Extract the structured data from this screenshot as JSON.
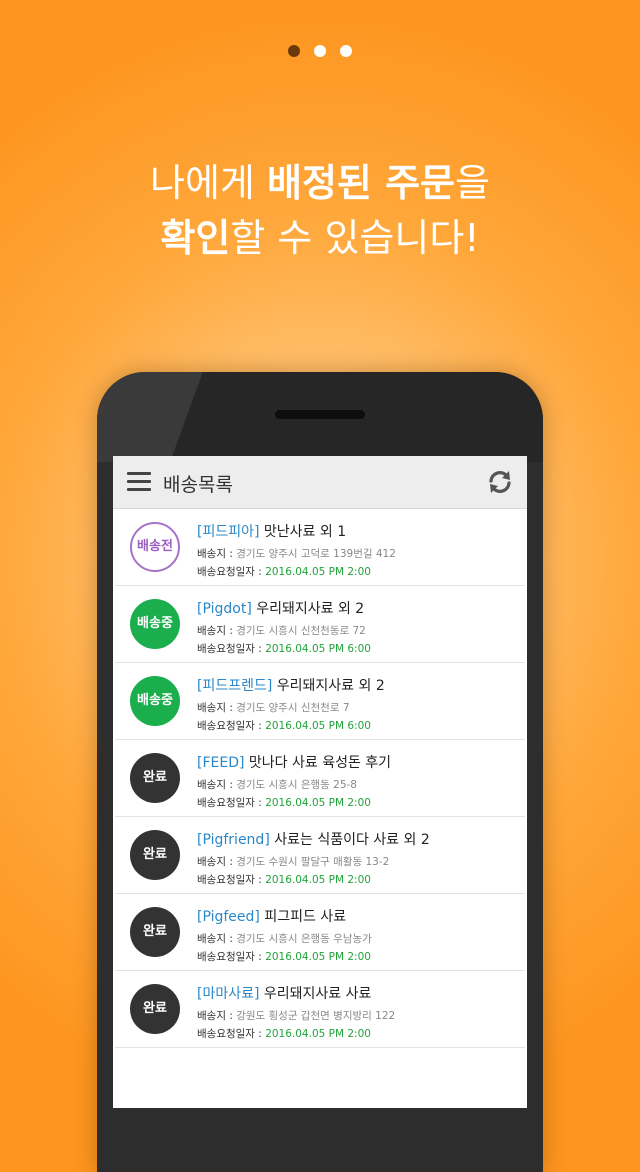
{
  "pager": {
    "active_index": 0,
    "count": 3
  },
  "headline": {
    "line1_normal_a": "나에게 ",
    "line1_bold": "배정된 주문",
    "line1_normal_b": "을",
    "line2_bold": "확인",
    "line2_normal": "할 수 있습니다!"
  },
  "appbar": {
    "title": "배송목록"
  },
  "labels": {
    "address": "배송지 : ",
    "date": "배송요청일자 : "
  },
  "orders": [
    {
      "status": "배송전",
      "status_type": "before",
      "shop": "[피드피아]",
      "product": " 맛난사료  외 1",
      "address": "경기도 양주시 고덕로 139번길 412",
      "date": "2016.04.05 PM 2:00"
    },
    {
      "status": "배송중",
      "status_type": "shipping",
      "shop": "[Pigdot]",
      "product": " 우리돼지사료  외 2",
      "address": "경기도 시흥시 신천천동로 72",
      "date": "2016.04.05 PM 6:00"
    },
    {
      "status": "배송중",
      "status_type": "shipping",
      "shop": "[피드프렌드]",
      "product": " 우리돼지사료  외 2",
      "address": "경기도 양주시 신천천로 7",
      "date": "2016.04.05 PM 6:00"
    },
    {
      "status": "완료",
      "status_type": "done",
      "shop": "[FEED]",
      "product": " 맛나다 사료 육성돈 후기",
      "address": "경기도 시흥시 은행동 25-8",
      "date": "2016.04.05 PM 2:00"
    },
    {
      "status": "완료",
      "status_type": "done",
      "shop": "[Pigfriend]",
      "product": " 사료는 식품이다 사료 외 2",
      "address": "경기도 수원시 팔달구 매활동 13-2",
      "date": "2016.04.05 PM 2:00"
    },
    {
      "status": "완료",
      "status_type": "done",
      "shop": "[Pigfeed]",
      "product": " 피그피드 사료",
      "address": "경기도 시흥시 은행동 우남농가",
      "date": "2016.04.05 PM 2:00"
    },
    {
      "status": "완료",
      "status_type": "done",
      "shop": "[마마사료]",
      "product": " 우리돼지사료  사료",
      "address": "강원도 횡성군 갑천면 병지방리 122",
      "date": "2016.04.05 PM 2:00"
    }
  ],
  "colors": {
    "background": "#fd951f",
    "shop_link": "#2a87c8",
    "date_text": "#22a33a",
    "badge_shipping": "#1aae4c",
    "badge_done": "#333333",
    "badge_before_border": "#a773c8"
  },
  "icons": {
    "menu": "hamburger-menu-icon",
    "refresh": "refresh-icon"
  }
}
